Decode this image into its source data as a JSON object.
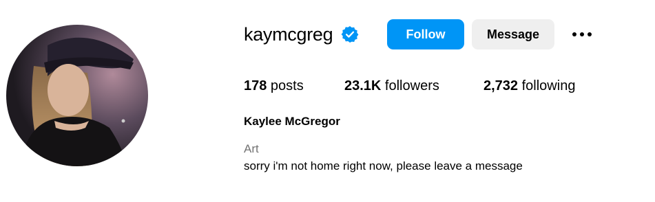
{
  "profile": {
    "username": "kaymcgreg",
    "verified_icon": "verified-badge-icon",
    "full_name": "Kaylee McGregor",
    "category": "Art",
    "bio": "sorry i'm not home right now, please leave a message"
  },
  "actions": {
    "follow_label": "Follow",
    "message_label": "Message",
    "more_icon": "more-options-icon"
  },
  "stats": {
    "posts_count": "178",
    "posts_label": " posts",
    "followers_count": "23.1K",
    "followers_label": " followers",
    "following_count": "2,732",
    "following_label": " following"
  },
  "colors": {
    "accent": "#0095f6",
    "secondary_button": "#efefef",
    "muted_text": "#737373"
  }
}
